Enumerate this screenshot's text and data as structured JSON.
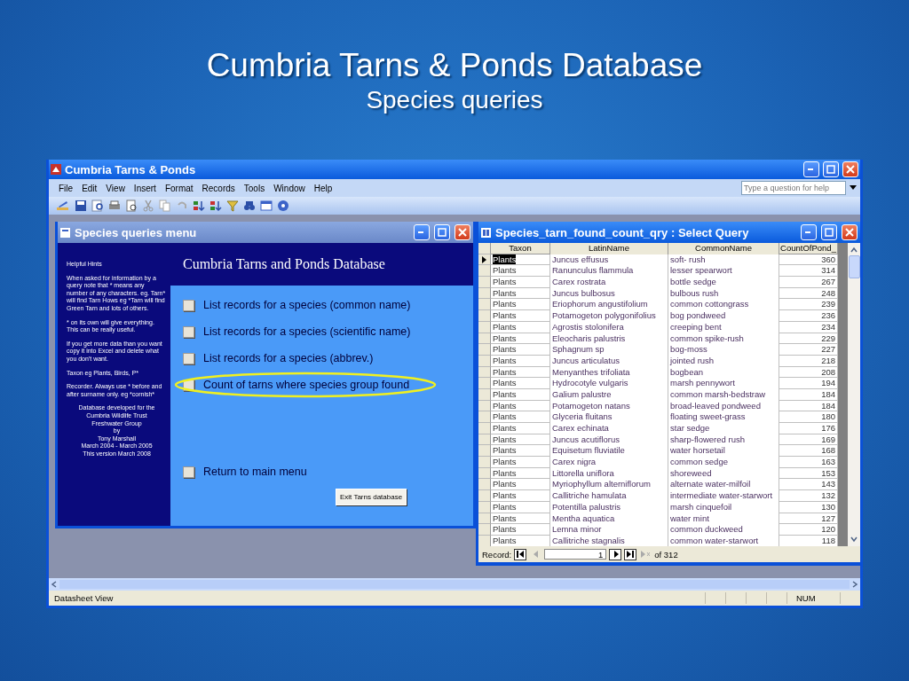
{
  "slide": {
    "title": "Cumbria Tarns & Ponds Database",
    "subtitle": "Species queries"
  },
  "window": {
    "title": "Cumbria Tarns & Ponds"
  },
  "menu": [
    "File",
    "Edit",
    "View",
    "Insert",
    "Format",
    "Records",
    "Tools",
    "Window",
    "Help"
  ],
  "help_search": {
    "placeholder": "Type a question for help"
  },
  "form": {
    "title": "Species queries menu",
    "hints_heading": "Helpful Hints",
    "hints": [
      "When asked for information by a query note that * means any number of any characters. eg. Tarn* will find Tarn Hows eg *Tarn will find Green Tarn and lots of others.",
      "* on its own will give everything. This can be really useful.",
      "If you get more data than you want copy it into Excel and delete what you don't want.",
      "Taxon eg Plants, Birds, P*",
      "Recorder. Always use * before and after surname only. eg *cornish*"
    ],
    "credits": [
      "Database developed for the",
      "Cumbria Wildlife Trust",
      "Freshwater Group",
      "by",
      "Tony Marshall",
      "March 2004 - March 2005",
      "This version March 2008"
    ],
    "heading": "Cumbria Tarns and Ponds Database",
    "options": [
      {
        "label": "List records for a species (common name)",
        "highlighted": false
      },
      {
        "label": "List records for a species (scientific name)",
        "highlighted": false
      },
      {
        "label": "List records for a species (abbrev.)",
        "highlighted": false
      },
      {
        "label": "Count of tarns where species group found",
        "highlighted": true
      }
    ],
    "return_option": {
      "label": "Return to main menu"
    },
    "exit_button": "Exit Tarns database"
  },
  "query": {
    "title": "Species_tarn_found_count_qry : Select Query",
    "columns": [
      "Taxon",
      "LatinName",
      "CommonName",
      "CountOfPond_"
    ],
    "rows": [
      {
        "cells": [
          "Plants",
          "Juncus effusus",
          "soft- rush",
          "360"
        ],
        "current": true
      },
      {
        "cells": [
          "Plants",
          "Ranunculus flammula",
          "lesser spearwort",
          "314"
        ],
        "current": false
      },
      {
        "cells": [
          "Plants",
          "Carex rostrata",
          "bottle sedge",
          "267"
        ],
        "current": false
      },
      {
        "cells": [
          "Plants",
          "Juncus bulbosus",
          "bulbous rush",
          "248"
        ],
        "current": false
      },
      {
        "cells": [
          "Plants",
          "Eriophorum angustifolium",
          "common  cottongrass",
          "239"
        ],
        "current": false
      },
      {
        "cells": [
          "Plants",
          "Potamogeton polygonifolius",
          "bog pondweed",
          "236"
        ],
        "current": false
      },
      {
        "cells": [
          "Plants",
          "Agrostis stolonifera",
          "creeping bent",
          "234"
        ],
        "current": false
      },
      {
        "cells": [
          "Plants",
          "Eleocharis palustris",
          "common  spike-rush",
          "229"
        ],
        "current": false
      },
      {
        "cells": [
          "Plants",
          "Sphagnum sp",
          "bog-moss",
          "227"
        ],
        "current": false
      },
      {
        "cells": [
          "Plants",
          "Juncus articulatus",
          "jointed rush",
          "218"
        ],
        "current": false
      },
      {
        "cells": [
          "Plants",
          "Menyanthes trifoliata",
          "bogbean",
          "208"
        ],
        "current": false
      },
      {
        "cells": [
          "Plants",
          "Hydrocotyle vulgaris",
          "marsh pennywort",
          "194"
        ],
        "current": false
      },
      {
        "cells": [
          "Plants",
          "Galium palustre",
          "common marsh-bedstraw",
          "184"
        ],
        "current": false
      },
      {
        "cells": [
          "Plants",
          "Potamogeton natans",
          "broad-leaved  pondweed",
          "184"
        ],
        "current": false
      },
      {
        "cells": [
          "Plants",
          "Glyceria fluitans",
          "floating sweet-grass",
          "180"
        ],
        "current": false
      },
      {
        "cells": [
          "Plants",
          "Carex echinata",
          "star sedge",
          "176"
        ],
        "current": false
      },
      {
        "cells": [
          "Plants",
          "Juncus acutiflorus",
          "sharp-flowered rush",
          "169"
        ],
        "current": false
      },
      {
        "cells": [
          "Plants",
          "Equisetum fluviatile",
          "water horsetail",
          "168"
        ],
        "current": false
      },
      {
        "cells": [
          "Plants",
          "Carex nigra",
          "common  sedge",
          "163"
        ],
        "current": false
      },
      {
        "cells": [
          "Plants",
          "Littorella uniflora",
          "shoreweed",
          "153"
        ],
        "current": false
      },
      {
        "cells": [
          "Plants",
          "Myriophyllum alterniflorum",
          "alternate water-milfoil",
          "143"
        ],
        "current": false
      },
      {
        "cells": [
          "Plants",
          "Callitriche hamulata",
          "intermediate water-starwort",
          "132"
        ],
        "current": false
      },
      {
        "cells": [
          "Plants",
          "Potentilla palustris",
          "marsh cinquefoil",
          "130"
        ],
        "current": false
      },
      {
        "cells": [
          "Plants",
          "Mentha aquatica",
          "water mint",
          "127"
        ],
        "current": false
      },
      {
        "cells": [
          "Plants",
          "Lemna minor",
          "common duckweed",
          "120"
        ],
        "current": false
      },
      {
        "cells": [
          "Plants",
          "Callitriche stagnalis",
          "common water-starwort",
          "118"
        ],
        "current": false
      }
    ],
    "record_label": "Record:",
    "record_value": "1",
    "record_total": "of 312"
  },
  "status_bar": {
    "mode": "Datasheet View",
    "num": "NUM"
  }
}
